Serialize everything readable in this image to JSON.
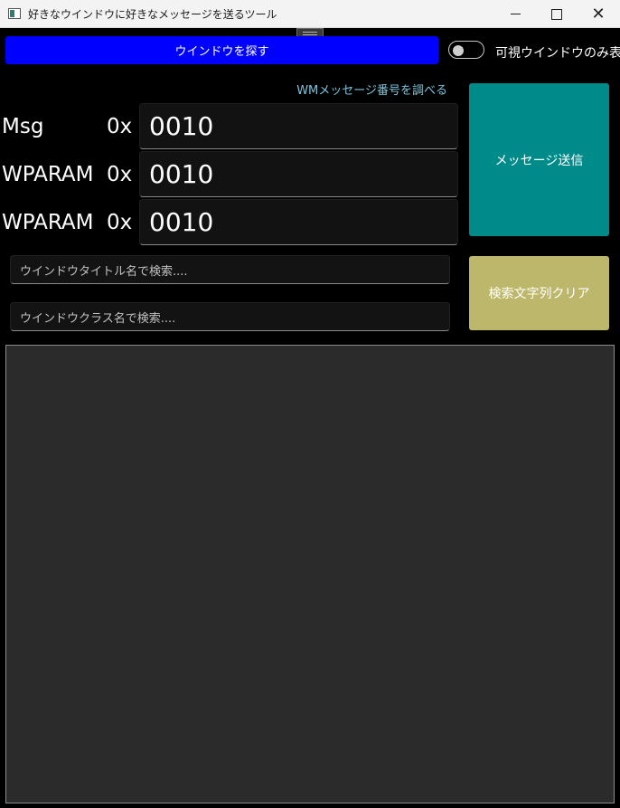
{
  "window": {
    "title": "好きなウインドウに好きなメッセージを送るツール",
    "icon": "app-window-icon",
    "controls": {
      "minimize_icon": "minimize-icon",
      "maximize_icon": "maximize-icon",
      "close_icon": "close-icon",
      "close_glyph": "✕"
    }
  },
  "toolbar": {
    "find_window_label": "ウインドウを探す",
    "visible_only_label": "可視ウインドウのみ表示",
    "visible_only_on": false
  },
  "wm_link_label": "WMメッセージ番号を調べる",
  "fields": [
    {
      "label": "Msg",
      "prefix": "0x",
      "value": "0010"
    },
    {
      "label": "WPARAM",
      "prefix": "0x",
      "value": "0010"
    },
    {
      "label": "WPARAM",
      "prefix": "0x",
      "value": "0010"
    }
  ],
  "send_label": "メッセージ送信",
  "clear_label": "検索文字列クリア",
  "search": {
    "title_placeholder": "ウインドウタイトル名で検索....",
    "class_placeholder": "ウインドウクラス名で検索...."
  },
  "colors": {
    "find_button": "#0000ff",
    "send_button": "#008b8b",
    "clear_button": "#bdb76b",
    "link": "#7fc4dc"
  }
}
